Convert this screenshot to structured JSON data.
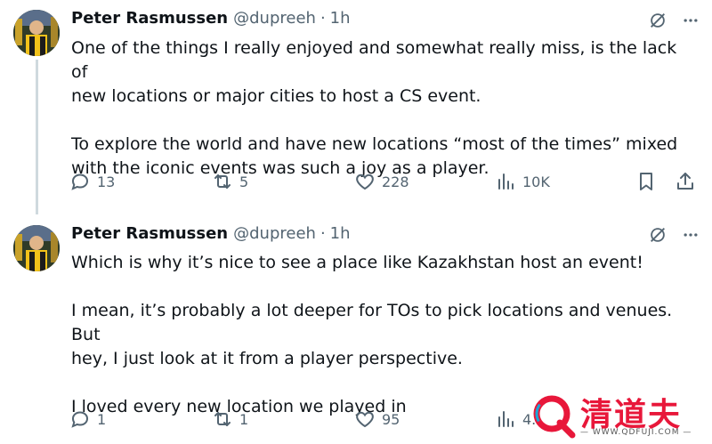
{
  "tweets": [
    {
      "author": "Peter Rasmussen",
      "handle": "@dupreeh",
      "separator": "·",
      "time": "1h",
      "text": "One of the things I really enjoyed and somewhat really miss, is the lack of\nnew locations or major cities to host a CS event.\n\nTo explore the world and have new locations “most of the times” mixed\nwith the iconic events was such a joy as a player.",
      "replies": "13",
      "retweets": "5",
      "likes": "228",
      "views": "10K"
    },
    {
      "author": "Peter Rasmussen",
      "handle": "@dupreeh",
      "separator": "·",
      "time": "1h",
      "text": "Which is why it’s nice to see a place like Kazakhstan host an event!\n\nI mean, it’s probably a lot deeper for TOs to pick locations and venues. But\nhey, I just look at it from a player perspective.\n\nI loved every new location we played in",
      "replies": "1",
      "retweets": "1",
      "likes": "95",
      "views": "4."
    }
  ],
  "watermark": {
    "title": "清道夫",
    "url": "— WWW.QDFUJI.COM —",
    "color": "#e8173a"
  },
  "colors": {
    "text": "#0f1419",
    "secondary": "#536471",
    "thread_line": "#cfd9de"
  },
  "icons": {
    "grok": "grok-icon",
    "more": "more-icon",
    "reply": "reply-icon",
    "retweet": "retweet-icon",
    "like": "heart-icon",
    "views": "views-icon",
    "bookmark": "bookmark-icon",
    "share": "share-icon"
  }
}
